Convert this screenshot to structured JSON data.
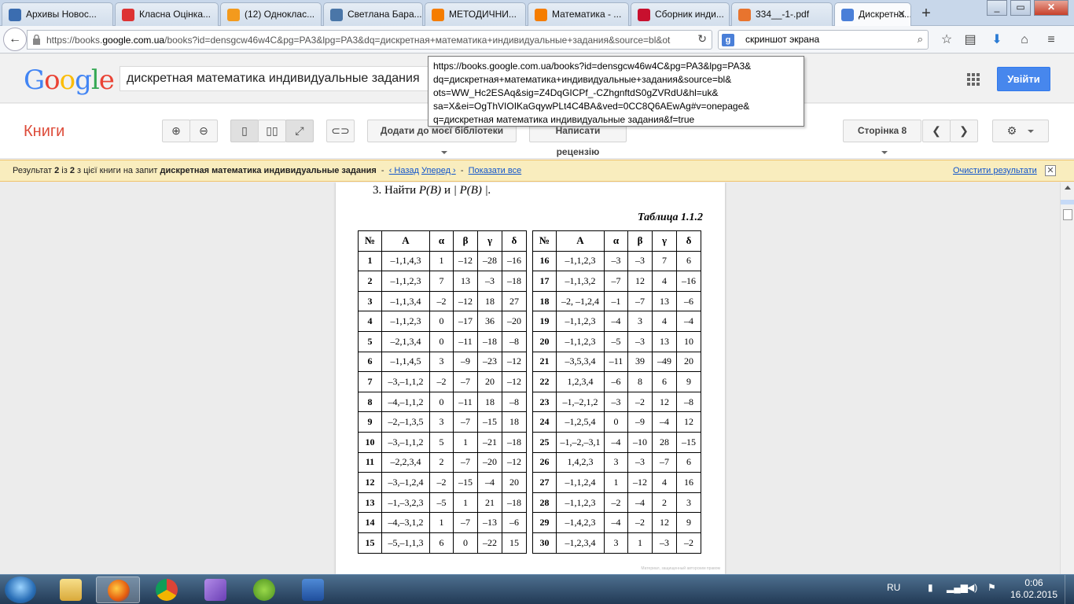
{
  "tabs": [
    {
      "label": "Архивы Новос...",
      "icon": "news-icon",
      "color": "#3b6db0"
    },
    {
      "label": "Класна Оцінка...",
      "icon": "refresh-icon",
      "color": "#d33"
    },
    {
      "label": "(12) Одноклас...",
      "icon": "ok-icon",
      "color": "#f39a1d"
    },
    {
      "label": "Светлана Бара...",
      "icon": "vk-icon",
      "color": "#4a76a8"
    },
    {
      "label": "МЕТОДИЧНИ...",
      "icon": "blogger-icon",
      "color": "#f57d00"
    },
    {
      "label": "Математика - ...",
      "icon": "blogger-icon",
      "color": "#f57d00"
    },
    {
      "label": "Сборник инди...",
      "icon": "pdf-icon",
      "color": "#c8102e"
    },
    {
      "label": "334__-1-.pdf",
      "icon": "download-icon",
      "color": "#e8742e"
    },
    {
      "label": "Дискретна...",
      "icon": "google-books-icon",
      "color": "#4a7fd8"
    }
  ],
  "url": {
    "prefix": "https://books.",
    "domain": "google.com.ua",
    "rest": "/books?id=densgcw46w4C&pg=PA3&lpg=PA3&dq=дискретная+математика+индивидуальные+задания&source=bl&ot"
  },
  "search_bar": {
    "value": "скриншот экрана"
  },
  "google": {
    "query": "дискретная математика индивидуальные задания",
    "signin": "Увійти"
  },
  "tooltip": [
    "https://books.google.com.ua/books?id=densgcw46w4C&pg=PA3&lpg=PA3&",
    "dq=дискретная+математика+индивидуальные+задания&source=bl&",
    "ots=WW_Hc2ESAq&sig=Z4DqGICPf_-CZhgnftdS0gZVRdU&hl=uk&",
    "sa=X&ei=OgThVIOIKaGqywPLt4C4BA&ved=0CC8Q6AEwAg#v=onepage&",
    "q=дискретная математика индивидуальные задания&f=true"
  ],
  "books": {
    "title": "Книги",
    "add_library": "Додати до моєї бібліотеки",
    "write_review": "Написати рецензію",
    "page_label": "Сторінка 8"
  },
  "result_bar": {
    "pre": "Результат",
    "current": "2",
    "of": "із",
    "total": "2",
    "mid": "з цієї книги на запит",
    "query": "дискретная математика индивидуальные задания",
    "dash1": "-",
    "back": "‹ Назад",
    "forward": "Уперед ›",
    "dash2": "-",
    "show_all": "Показати все",
    "clear": "Очистити результати"
  },
  "page_content": {
    "task_num": "3. Найти",
    "task_expr1": "P(B)",
    "task_and": "и",
    "task_expr2": "| P(B) |.",
    "caption": "Таблица 1.1.2",
    "headers": [
      "№",
      "A",
      "α",
      "β",
      "γ",
      "δ"
    ],
    "watermark": "Материал, защищенный авторским правом"
  },
  "table_left": [
    [
      "1",
      "–1,1,4,3",
      "1",
      "–12",
      "–28",
      "–16"
    ],
    [
      "2",
      "–1,1,2,3",
      "7",
      "13",
      "–3",
      "–18"
    ],
    [
      "3",
      "–1,1,3,4",
      "–2",
      "–12",
      "18",
      "27"
    ],
    [
      "4",
      "–1,1,2,3",
      "0",
      "–17",
      "36",
      "–20"
    ],
    [
      "5",
      "–2,1,3,4",
      "0",
      "–11",
      "–18",
      "–8"
    ],
    [
      "6",
      "–1,1,4,5",
      "3",
      "–9",
      "–23",
      "–12"
    ],
    [
      "7",
      "–3,–1,1,2",
      "–2",
      "–7",
      "20",
      "–12"
    ],
    [
      "8",
      "–4,–1,1,2",
      "0",
      "–11",
      "18",
      "–8"
    ],
    [
      "9",
      "–2,–1,3,5",
      "3",
      "–7",
      "–15",
      "18"
    ],
    [
      "10",
      "–3,–1,1,2",
      "5",
      "1",
      "–21",
      "–18"
    ],
    [
      "11",
      "–2,2,3,4",
      "2",
      "–7",
      "–20",
      "–12"
    ],
    [
      "12",
      "–3,–1,2,4",
      "–2",
      "–15",
      "–4",
      "20"
    ],
    [
      "13",
      "–1,–3,2,3",
      "–5",
      "1",
      "21",
      "–18"
    ],
    [
      "14",
      "–4,–3,1,2",
      "1",
      "–7",
      "–13",
      "–6"
    ],
    [
      "15",
      "–5,–1,1,3",
      "6",
      "0",
      "–22",
      "15"
    ]
  ],
  "table_right": [
    [
      "16",
      "–1,1,2,3",
      "–3",
      "–3",
      "7",
      "6"
    ],
    [
      "17",
      "–1,1,3,2",
      "–7",
      "12",
      "4",
      "–16"
    ],
    [
      "18",
      "–2, –1,2,4",
      "–1",
      "–7",
      "13",
      "–6"
    ],
    [
      "19",
      "–1,1,2,3",
      "–4",
      "3",
      "4",
      "–4"
    ],
    [
      "20",
      "–1,1,2,3",
      "–5",
      "–3",
      "13",
      "10"
    ],
    [
      "21",
      "–3,5,3,4",
      "–11",
      "39",
      "–49",
      "20"
    ],
    [
      "22",
      "1,2,3,4",
      "–6",
      "8",
      "6",
      "9"
    ],
    [
      "23",
      "–1,–2,1,2",
      "–3",
      "–2",
      "12",
      "–8"
    ],
    [
      "24",
      "–1,2,5,4",
      "0",
      "–9",
      "–4",
      "12"
    ],
    [
      "25",
      "–1,–2,–3,1",
      "–4",
      "–10",
      "28",
      "–15"
    ],
    [
      "26",
      "1,4,2,3",
      "3",
      "–3",
      "–7",
      "6"
    ],
    [
      "27",
      "–1,1,2,4",
      "1",
      "–12",
      "4",
      "16"
    ],
    [
      "28",
      "–1,1,2,3",
      "–2",
      "–4",
      "2",
      "3"
    ],
    [
      "29",
      "–1,4,2,3",
      "–4",
      "–2",
      "12",
      "9"
    ],
    [
      "30",
      "–1,2,3,4",
      "3",
      "1",
      "–3",
      "–2"
    ]
  ],
  "taskbar": {
    "lang": "RU",
    "time": "0:06",
    "date": "16.02.2015"
  }
}
